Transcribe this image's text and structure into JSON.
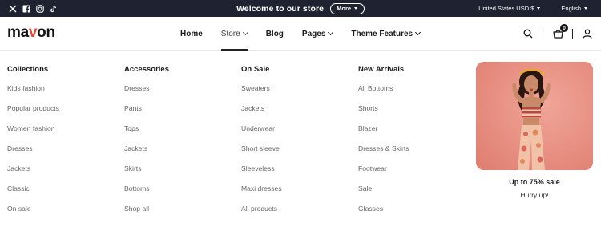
{
  "colors": {
    "topbar_bg": "#1f2230",
    "promo_bg": "#e78a7c",
    "logo_accent": "#e0473b"
  },
  "topbar": {
    "social_icons": [
      "x-icon",
      "facebook-icon",
      "instagram-icon",
      "tiktok-icon"
    ],
    "announcement": "Welcome to our store",
    "more_label": "More",
    "currency": "United States USD $",
    "language": "English"
  },
  "header": {
    "logo_part1": "ma",
    "logo_accent": "v",
    "logo_part2": "on",
    "nav": [
      {
        "label": "Home"
      },
      {
        "label": "Store"
      },
      {
        "label": "Blog"
      },
      {
        "label": "Pages"
      },
      {
        "label": "Theme Features"
      }
    ],
    "cart_count": "0",
    "icons": [
      "search-icon",
      "cart-icon",
      "user-icon"
    ]
  },
  "mega_menu": {
    "columns": [
      {
        "title": "Collections",
        "links": [
          "Kids fashion",
          "Popular products",
          "Women fashion",
          "Dresses",
          "Jackets",
          "Classic",
          "On sale"
        ]
      },
      {
        "title": "Accessories",
        "links": [
          "Dresses",
          "Pants",
          "Tops",
          "Jackets",
          "Skirts",
          "Bottoms",
          "Shop all"
        ]
      },
      {
        "title": "On Sale",
        "links": [
          "Sweaters",
          "Jackets",
          "Underwear",
          "Short sleeve",
          "Sleeveless",
          "Maxi dresses",
          "All products"
        ]
      },
      {
        "title": "New Arrivals",
        "links": [
          "All Bottoms",
          "Shorts",
          "Blazer",
          "Dresses & Skirts",
          "Footwear",
          "Sale",
          "Glasses"
        ]
      }
    ],
    "promo": {
      "title": "Up to 75% sale",
      "subtitle": "Hurry up!"
    }
  }
}
